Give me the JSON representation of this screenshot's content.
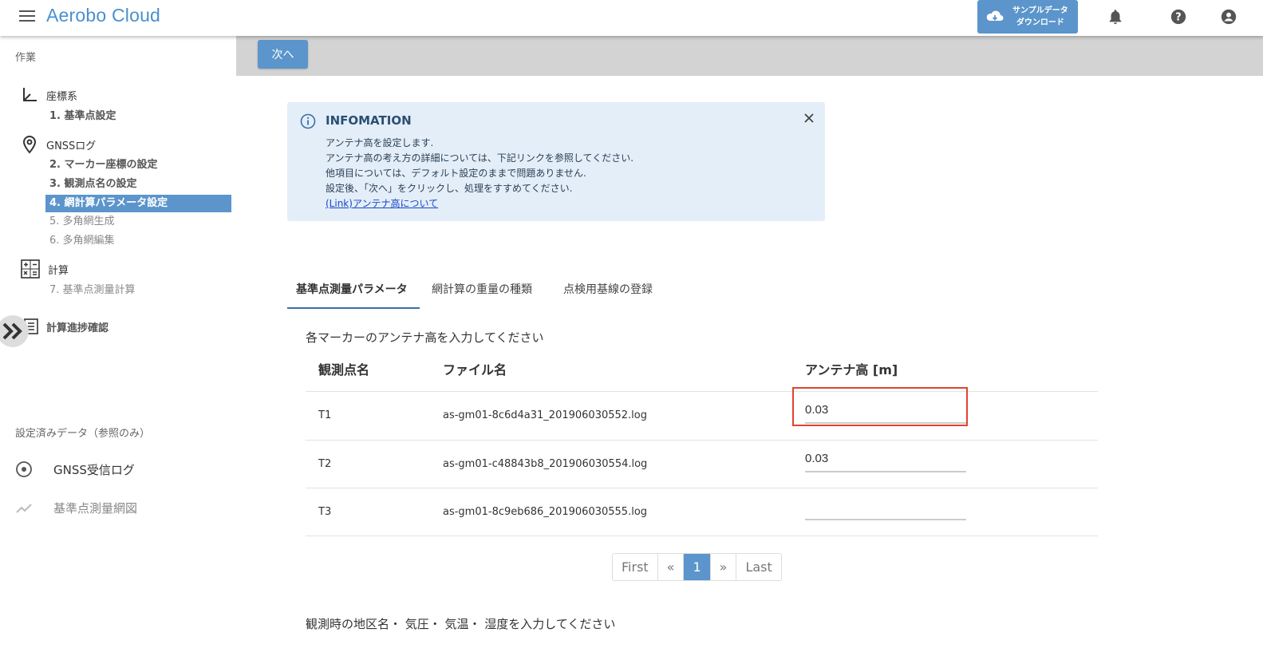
{
  "header": {
    "title": "Aerobo Cloud",
    "sample_line1": "サンプルデータ",
    "sample_line2": "ダウンロード"
  },
  "sidebar": {
    "section_work": "作業",
    "groups": [
      {
        "label": "座標系",
        "items": [
          {
            "label": "1. 基準点設定",
            "state": "done"
          }
        ]
      },
      {
        "label": "GNSSログ",
        "items": [
          {
            "label": "2. マーカー座標の設定",
            "state": "done"
          },
          {
            "label": "3. 観測点名の設定",
            "state": "done"
          },
          {
            "label": "4. 網計算パラメータ設定",
            "state": "active"
          },
          {
            "label": "5. 多角網生成",
            "state": "todo"
          },
          {
            "label": "6. 多角網編集",
            "state": "todo"
          }
        ]
      },
      {
        "label": "計算",
        "items": [
          {
            "label": "7. 基準点測量計算",
            "state": "todo"
          }
        ]
      },
      {
        "label": "計算進捗確認",
        "items": []
      }
    ],
    "section_ref": "設定済みデータ（参照のみ）",
    "ref_items": [
      {
        "label": "GNSS受信ログ"
      },
      {
        "label": "基準点測量網図"
      }
    ]
  },
  "toolbar": {
    "next_label": "次へ"
  },
  "info": {
    "title": "INFOMATION",
    "lines": [
      "アンテナ高を設定します.",
      "アンテナ高の考え方の詳細については、下記リンクを参照してください.",
      "他項目については、デフォルト設定のままで問題ありません.",
      "設定後、「次へ」をクリックし、処理をすすめてください."
    ],
    "link": "(Link)アンテナ高について"
  },
  "tabs": [
    {
      "label": "基準点測量パラメータ",
      "active": true
    },
    {
      "label": "網計算の重量の種類",
      "active": false
    },
    {
      "label": "点検用基線の登録",
      "active": false
    }
  ],
  "antenna_section": {
    "title": "各マーカーのアンテナ高を入力してください",
    "columns": [
      "観測点名",
      "ファイル名",
      "アンテナ高 [m]"
    ],
    "rows": [
      {
        "name": "T1",
        "file": "as-gm01-8c6d4a31_201906030552.log",
        "height": "0.03"
      },
      {
        "name": "T2",
        "file": "as-gm01-c48843b8_201906030554.log",
        "height": "0.03"
      },
      {
        "name": "T3",
        "file": "as-gm01-8c9eb686_201906030555.log",
        "height": ""
      }
    ]
  },
  "pager": {
    "first": "First",
    "prev": "«",
    "current": "1",
    "next": "»",
    "last": "Last"
  },
  "weather_section": {
    "title": "観測時の地区名・ 気圧・ 気温・ 湿度を入力してください"
  },
  "colors": {
    "accent": "#5b95cb",
    "highlight": "#e0442e",
    "info_bg": "#e3eef9"
  }
}
